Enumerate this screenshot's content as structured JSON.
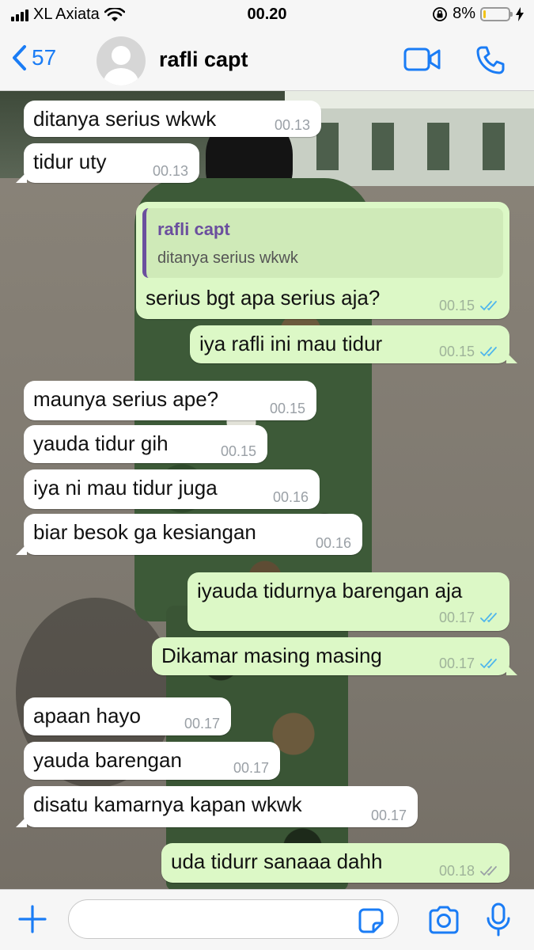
{
  "status_bar": {
    "carrier": "XL Axiata",
    "time": "00.20",
    "battery_percent": "8%",
    "battery_level": 0.08
  },
  "header": {
    "back_count": "57",
    "contact_name": "rafli capt"
  },
  "messages": [
    {
      "dir": "in",
      "text": "ditanya serius wkwk",
      "time": "00.13"
    },
    {
      "dir": "in",
      "text": "tidur uty",
      "time": "00.13",
      "tail": true
    },
    {
      "dir": "out",
      "text": "serius bgt apa serius aja?",
      "time": "00.15",
      "ticks": "read",
      "quote": {
        "name": "rafli capt",
        "text": "ditanya serius wkwk"
      }
    },
    {
      "dir": "out",
      "text": "iya rafli ini mau tidur",
      "time": "00.15",
      "ticks": "read",
      "tail": true
    },
    {
      "dir": "in",
      "text": "maunya serius ape?",
      "time": "00.15"
    },
    {
      "dir": "in",
      "text": "yauda tidur gih",
      "time": "00.15"
    },
    {
      "dir": "in",
      "text": "iya ni mau tidur juga",
      "time": "00.16"
    },
    {
      "dir": "in",
      "text": "biar besok ga kesiangan",
      "time": "00.16",
      "tail": true
    },
    {
      "dir": "out",
      "text": "iyauda tidurnya barengan aja",
      "time": "00.17",
      "ticks": "read"
    },
    {
      "dir": "out",
      "text": "Dikamar masing masing",
      "time": "00.17",
      "ticks": "read",
      "tail": true
    },
    {
      "dir": "in",
      "text": "apaan hayo",
      "time": "00.17"
    },
    {
      "dir": "in",
      "text": "yauda barengan",
      "time": "00.17"
    },
    {
      "dir": "in",
      "text": "disatu kamarnya kapan wkwk",
      "time": "00.17",
      "tail": true
    },
    {
      "dir": "out",
      "text": "uda tidurr sanaaa dahh",
      "time": "00.18",
      "ticks": "delivered"
    }
  ],
  "input": {
    "placeholder": ""
  },
  "colors": {
    "accent": "#1a7cf5",
    "outgoing_bubble": "#dcf8c6",
    "incoming_bubble": "#ffffff",
    "read_ticks": "#4fb6ec",
    "delivered_ticks": "#9aa0a6",
    "quote_name": "#6b4f9e",
    "battery": "#f2c318"
  },
  "icons": {
    "back": "chevron-left-icon",
    "video": "video-camera-icon",
    "call": "phone-icon",
    "plus": "plus-icon",
    "sticker": "sticker-icon",
    "camera": "camera-icon",
    "mic": "microphone-icon"
  }
}
